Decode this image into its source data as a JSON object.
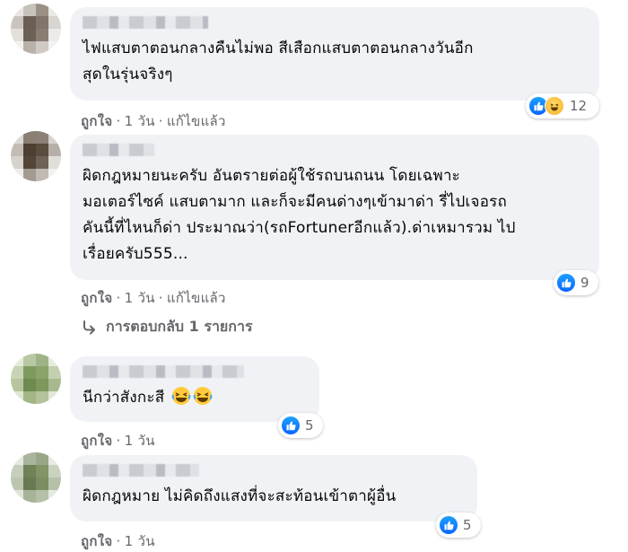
{
  "comments": [
    {
      "text_line1": "ไฟแสบตาตอนกลางคืนไม่พอ สีเสือกแสบตาตอนกลางวันอีก",
      "text_line2": "สุดในรุ่นจริงๆ",
      "like_label": "ถูกใจ",
      "time": "1 วัน",
      "edited": "แก้ไขแล้ว",
      "reaction_count": "12",
      "reactions": [
        "like-icon",
        "haha-icon"
      ]
    },
    {
      "text_line1": "ผิดกฎหมายนะครับ อันตรายต่อผู้ใช้รถบนถนน โดยเฉพาะ",
      "text_line2": "มอเตอร์ไซค์ แสบตามาก และก็จะมีคนด่างๆเข้ามาด่า รี่ไปเจอรถ",
      "text_line3": "คันนี้ที่ไหนก็ด่า ประมาณว่า(รถFortunerอีกแล้ว).ด่าเหมารวม ไป",
      "text_line4": "เรื่อยครับ555...",
      "like_label": "ถูกใจ",
      "time": "1 วัน",
      "edited": "แก้ไขแล้ว",
      "reaction_count": "9",
      "reactions": [
        "like-icon"
      ],
      "reply_label": "การตอบกลับ 1 รายการ"
    },
    {
      "text_line1": "นีกว่าสังกะสี",
      "like_label": "ถูกใจ",
      "time": "1 วัน",
      "reaction_count": "5",
      "reactions": [
        "like-icon"
      ]
    },
    {
      "text_line1": "ผิดกฎหมาย ไม่คิดถึงแสงที่จะสะท้อนเข้าตาผู้อื่น",
      "like_label": "ถูกใจ",
      "time": "1 วัน",
      "reaction_count": "5",
      "reactions": [
        "like-icon"
      ]
    }
  ],
  "colors": {
    "bubble": "#f0f2f5",
    "secondary_text": "#65676b",
    "like_blue": "#0866ff"
  }
}
